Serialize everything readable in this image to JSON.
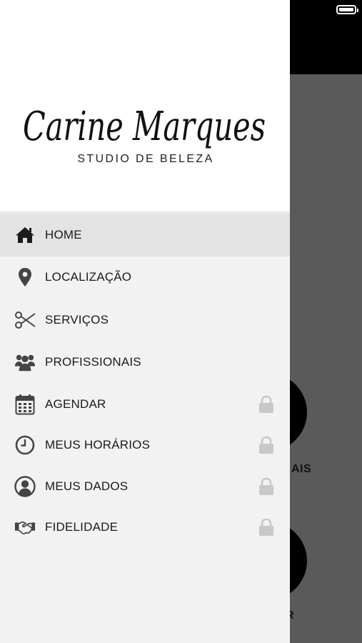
{
  "logo": {
    "script_name": "Carine Marques",
    "subtitle": "STUDIO DE BELEZA"
  },
  "menu": {
    "items": [
      {
        "label": "HOME",
        "icon": "home-icon",
        "active": true,
        "locked": false
      },
      {
        "label": "LOCALIZAÇÃO",
        "icon": "location-pin-icon",
        "active": false,
        "locked": false
      },
      {
        "label": "SERVIÇOS",
        "icon": "scissors-icon",
        "active": false,
        "locked": false
      },
      {
        "label": "PROFISSIONAIS",
        "icon": "group-icon",
        "active": false,
        "locked": false
      },
      {
        "label": "AGENDAR",
        "icon": "calendar-icon",
        "active": false,
        "locked": true
      },
      {
        "label": "MEUS HORÁRIOS",
        "icon": "clock-icon",
        "active": false,
        "locked": true
      },
      {
        "label": "MEUS DADOS",
        "icon": "user-circle-icon",
        "active": false,
        "locked": true
      },
      {
        "label": "FIDELIDADE",
        "icon": "handshake-icon",
        "active": false,
        "locked": true
      }
    ]
  },
  "background": {
    "label_1": "AIS",
    "label_2": "R"
  },
  "colors": {
    "drawer_bg": "#f2f2f2",
    "active_bg": "#e3e3e3",
    "icon": "#333333",
    "lock": "#c8c8c8",
    "overlay": "#5a5a5a"
  }
}
